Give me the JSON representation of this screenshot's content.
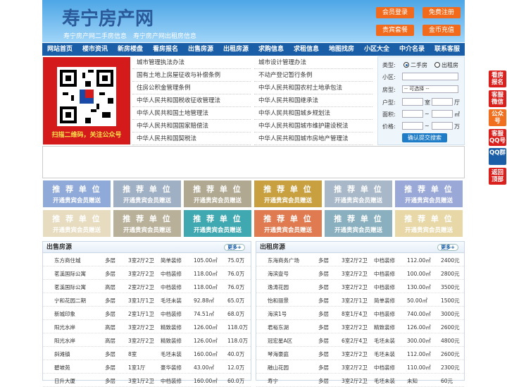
{
  "header": {
    "title": "寿宁房产网",
    "subtitle": "寿宁房产网二手房信息　寿宁房产网出租房信息",
    "buttons": [
      "会员登录",
      "免费注册",
      "贵宾套餐",
      "金币充值"
    ]
  },
  "nav": [
    "网站首页",
    "楼市资讯",
    "新房楼盘",
    "看房报名",
    "出售房源",
    "出租房源",
    "求购信息",
    "求租信息",
    "地图找房",
    "小区大全",
    "中介名录",
    "联系客服"
  ],
  "qr": {
    "caption": "扫描二维码，关注公众号"
  },
  "links": [
    "城市管理执法办法",
    "城市设计管理办法",
    "国有土地上房屋征收与补偿条例",
    "不动产登记暂行条例",
    "住房公积金管理条例",
    "中华人民共和国农村土地承包法",
    "中华人民共和国税收征收管理法",
    "中华人民共和国继承法",
    "中华人民共和国土地管理法",
    "中华人民共和国城乡规划法",
    "中华人民共和国国家赔偿法",
    "中华人民共和国城市维护建设税法",
    "中华人民共和国契税法",
    "中华人民共和国城市房地产管理法"
  ],
  "search": {
    "type_label": "类型:",
    "opt1": "二手房",
    "opt2": "出租房",
    "area_label": "小区:",
    "room_label": "房型:",
    "room_select": "-- 可选择 --",
    "layout_label": "户型:",
    "shi": "室",
    "ting": "厅",
    "size_label": "面积:",
    "size_unit": "㎡",
    "price_label": "价格:",
    "price_unit": "万",
    "tilde": "~",
    "submit": "确认提交搜索"
  },
  "ads": {
    "line1": "推 荐 单 位",
    "line2": "开通贵宾会员赠送",
    "colors": [
      "#8fa9d8",
      "#a0b0c4",
      "#b0a890",
      "#c8a040",
      "#a8b8c8",
      "#9aa8d8",
      "#e8dcc0",
      "#b8b098",
      "#40a8b0",
      "#e07a50",
      "#8ab0c0",
      "#e8d8a8"
    ]
  },
  "sale": {
    "title": "出售房源",
    "more": "更多+",
    "rows": [
      [
        "东方商住城",
        "多层",
        "3室2厅2卫",
        "简单装修",
        "105.00㎡",
        "75.0万"
      ],
      [
        "茗溪国际公寓",
        "多层",
        "3室2厅2卫",
        "中档装修",
        "118.00㎡",
        "76.0万"
      ],
      [
        "茗溪国际公寓",
        "高层",
        "2室2厅2卫",
        "中档装修",
        "118.00㎡",
        "76.0万"
      ],
      [
        "宁和花园二期",
        "多层",
        "3室1厅1卫",
        "毛坯未装",
        "92.88㎡",
        "65.0万"
      ],
      [
        "新城印象",
        "多层",
        "2室1厅1卫",
        "中档装修",
        "74.51㎡",
        "68.0万"
      ],
      [
        "阳光水岸",
        "高层",
        "3室2厅2卫",
        "精致装修",
        "126.00㎡",
        "118.0万"
      ],
      [
        "阳光水岸",
        "高层",
        "3室2厅2卫",
        "精致装修",
        "126.00㎡",
        "118.0万"
      ],
      [
        "斜滩镇",
        "多层",
        "8室",
        "毛坯未装",
        "160.00㎡",
        "40.0万"
      ],
      [
        "碧坡苑",
        "多层",
        "1室1厅",
        "豪华装修",
        "43.00㎡",
        "12.0万"
      ],
      [
        "日升大厦",
        "多层",
        "3室1厅2卫",
        "中档装修",
        "160.00㎡",
        "60.0万"
      ]
    ]
  },
  "rent": {
    "title": "出租房源",
    "more": "更多+",
    "rows": [
      [
        "东海商务广场",
        "多层",
        "3室2厅2卫",
        "中档装修",
        "112.00㎡",
        "2400元"
      ],
      [
        "海滨壹号",
        "多层",
        "3室2厅2卫",
        "中档装修",
        "100.00㎡",
        "2800元"
      ],
      [
        "逸涛花园",
        "多层",
        "3室2厅2卫",
        "中档装修",
        "130.00㎡",
        "3500元"
      ],
      [
        "怡和丽景",
        "多层",
        "3室2厅1卫",
        "简单装修",
        "50.00㎡",
        "1500元"
      ],
      [
        "海滨1号",
        "多层",
        "8室1厅4卫",
        "中档装修",
        "740.00㎡",
        "3000元"
      ],
      [
        "君裕东湖",
        "多层",
        "3室2厅2卫",
        "精致装修",
        "126.00㎡",
        "2600元"
      ],
      [
        "冠宏星A区",
        "多层",
        "6室2厅4卫",
        "毛坯未装",
        "300.00㎡",
        "4800元"
      ],
      [
        "琴海豪庭",
        "多层",
        "3室2厅2卫",
        "毛坯未装",
        "112.00㎡",
        "2600元"
      ],
      [
        "融山花园",
        "多层",
        "3室2厅2卫",
        "中档装修",
        "110.00㎡",
        "2300元"
      ],
      [
        "寿宁",
        "多层",
        "3室2厅2卫",
        "毛坯未装",
        "未知",
        "60元"
      ]
    ]
  },
  "sidebar": [
    "看房报名",
    "客服微信",
    "公众号",
    "客服QQ号",
    "QQ群",
    "返回顶部"
  ],
  "sidebar_colors": [
    "#d9201c",
    "#d9201c",
    "#f07020",
    "#d9201c",
    "#1a5ea8",
    "#d9201c"
  ]
}
